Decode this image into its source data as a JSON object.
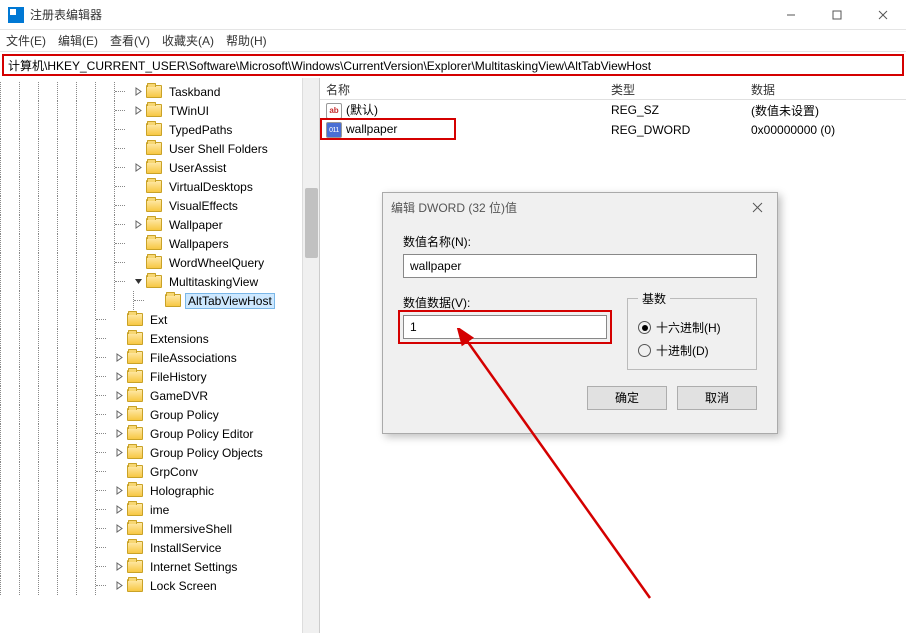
{
  "window": {
    "title": "注册表编辑器"
  },
  "menu": {
    "file": "文件(E)",
    "edit": "编辑(E)",
    "view": "查看(V)",
    "favorites": "收藏夹(A)",
    "help": "帮助(H)"
  },
  "address": {
    "path": "计算机\\HKEY_CURRENT_USER\\Software\\Microsoft\\Windows\\CurrentVersion\\Explorer\\MultitaskingView\\AltTabViewHost"
  },
  "tree": [
    {
      "depth": 7,
      "chev": "right",
      "label": "Taskband"
    },
    {
      "depth": 7,
      "chev": "right",
      "label": "TWinUI"
    },
    {
      "depth": 7,
      "chev": "",
      "label": "TypedPaths"
    },
    {
      "depth": 7,
      "chev": "",
      "label": "User Shell Folders"
    },
    {
      "depth": 7,
      "chev": "right",
      "label": "UserAssist"
    },
    {
      "depth": 7,
      "chev": "",
      "label": "VirtualDesktops"
    },
    {
      "depth": 7,
      "chev": "",
      "label": "VisualEffects"
    },
    {
      "depth": 7,
      "chev": "right",
      "label": "Wallpaper"
    },
    {
      "depth": 7,
      "chev": "",
      "label": "Wallpapers"
    },
    {
      "depth": 7,
      "chev": "",
      "label": "WordWheelQuery"
    },
    {
      "depth": 7,
      "chev": "down",
      "label": "MultitaskingView"
    },
    {
      "depth": 8,
      "chev": "",
      "label": "AltTabViewHost",
      "selected": true
    },
    {
      "depth": 6,
      "chev": "",
      "label": "Ext"
    },
    {
      "depth": 6,
      "chev": "",
      "label": "Extensions"
    },
    {
      "depth": 6,
      "chev": "right",
      "label": "FileAssociations"
    },
    {
      "depth": 6,
      "chev": "right",
      "label": "FileHistory"
    },
    {
      "depth": 6,
      "chev": "right",
      "label": "GameDVR"
    },
    {
      "depth": 6,
      "chev": "right",
      "label": "Group Policy"
    },
    {
      "depth": 6,
      "chev": "right",
      "label": "Group Policy Editor"
    },
    {
      "depth": 6,
      "chev": "right",
      "label": "Group Policy Objects"
    },
    {
      "depth": 6,
      "chev": "",
      "label": "GrpConv"
    },
    {
      "depth": 6,
      "chev": "right",
      "label": "Holographic"
    },
    {
      "depth": 6,
      "chev": "right",
      "label": "ime"
    },
    {
      "depth": 6,
      "chev": "right",
      "label": "ImmersiveShell"
    },
    {
      "depth": 6,
      "chev": "",
      "label": "InstallService"
    },
    {
      "depth": 6,
      "chev": "right",
      "label": "Internet Settings"
    },
    {
      "depth": 6,
      "chev": "right",
      "label": "Lock Screen"
    }
  ],
  "list": {
    "headers": {
      "name": "名称",
      "type": "类型",
      "data": "数据"
    },
    "rows": [
      {
        "icon": "str",
        "name": "(默认)",
        "type": "REG_SZ",
        "data": "(数值未设置)"
      },
      {
        "icon": "bin",
        "name": "wallpaper",
        "type": "REG_DWORD",
        "data": "0x00000000 (0)"
      }
    ]
  },
  "dialog": {
    "title": "编辑 DWORD (32 位)值",
    "name_label": "数值名称(N):",
    "name_value": "wallpaper",
    "data_label": "数值数据(V):",
    "data_value": "1",
    "radix_legend": "基数",
    "radix_hex": "十六进制(H)",
    "radix_dec": "十进制(D)",
    "ok": "确定",
    "cancel": "取消"
  }
}
